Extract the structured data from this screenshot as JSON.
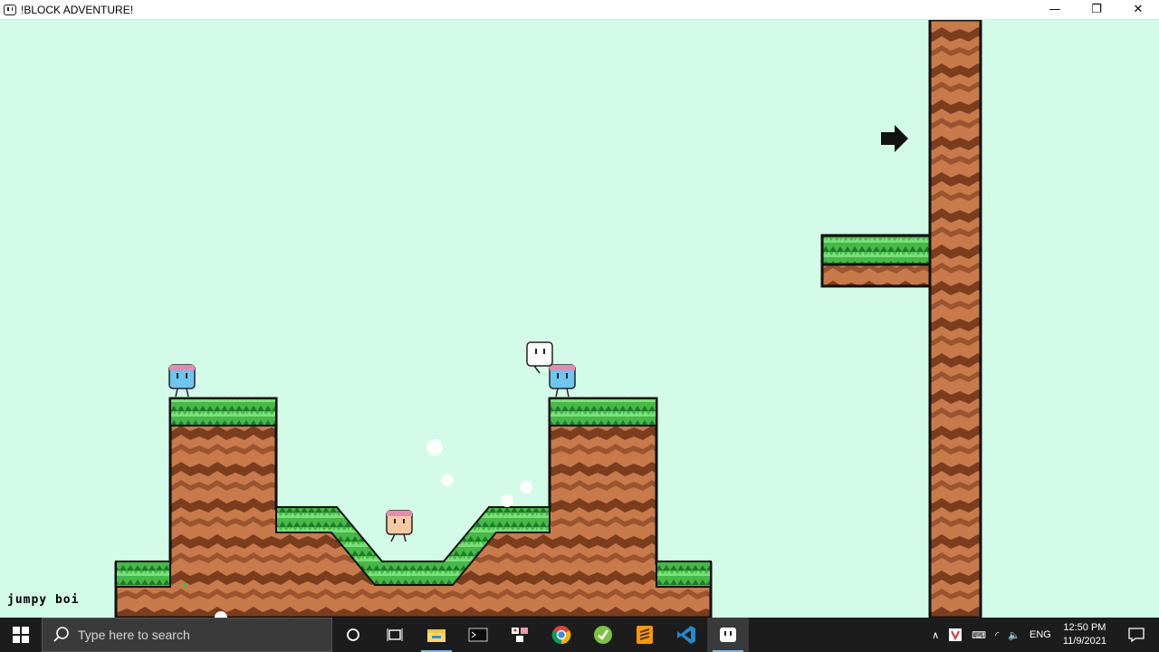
{
  "window": {
    "title": "!BLOCK ADVENTURE!",
    "controls": {
      "minimize": "—",
      "restore": "❐",
      "close": "✕"
    }
  },
  "game": {
    "background": "#d2fce8",
    "player_label": "jumpy boi",
    "characters": [
      {
        "name": "player-white-block",
        "color": "#ffffff"
      },
      {
        "name": "enemy-blue-block-left",
        "color": "#6ec6f0"
      },
      {
        "name": "enemy-blue-block-right",
        "color": "#6ec6f0"
      },
      {
        "name": "enemy-peach-block",
        "color": "#f7c9a3"
      }
    ],
    "colors": {
      "grass": "#3cb43c",
      "dirt_light": "#c87a4a",
      "dirt_dark": "#7a3e1e",
      "outline": "#111111"
    }
  },
  "taskbar": {
    "search_placeholder": "Type here to search",
    "apps": [
      "task-view-icon",
      "file-explorer-icon",
      "terminal-icon",
      "app-icon",
      "chrome-icon",
      "app-green-icon",
      "sublime-icon",
      "vscode-icon",
      "block-adventure-icon"
    ],
    "tray": {
      "lang": "ENG",
      "time": "12:50 PM",
      "date": "11/9/2021"
    }
  }
}
